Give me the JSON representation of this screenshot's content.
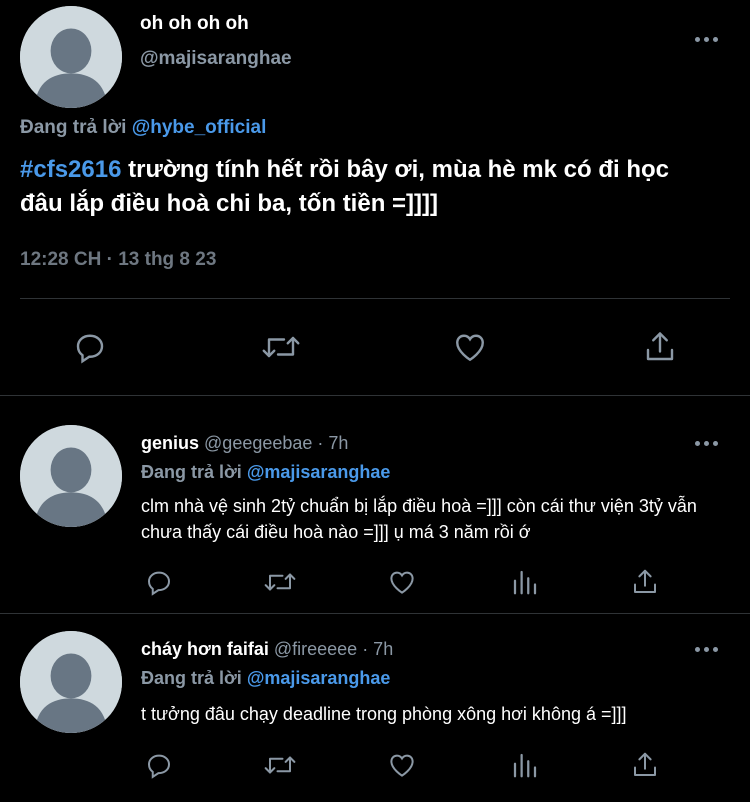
{
  "main_tweet": {
    "display_name": "oh oh oh oh",
    "handle": "@majisaranghae",
    "replying_label": "Đang trả lời",
    "replying_to": "@hybe_official",
    "hashtag": "#cfs2616",
    "text": " trường tính hết rồi bây ơi, mùa hè mk có đi học đâu lắp điều hoà chi ba, tốn tiền =]]]]",
    "timestamp": "12:28 CH · 13 thg 8 23",
    "actions": [
      "reply-icon",
      "retweet-icon",
      "like-icon",
      "share-icon"
    ]
  },
  "replies": [
    {
      "display_name": "genius",
      "handle": "@geegeebae",
      "time": "· 7h",
      "replying_label": "Đang trả lời",
      "replying_to": "@majisaranghae",
      "text": "clm nhà vệ sinh 2tỷ chuẩn bị lắp điều hoà =]]] còn cái thư viện 3tỷ vẫn chưa thấy cái điều hoà nào =]]] ụ má 3 năm rồi ớ",
      "actions": [
        "reply-icon",
        "retweet-icon",
        "like-icon",
        "views-icon",
        "share-icon"
      ]
    },
    {
      "display_name": "cháy hơn faifai",
      "handle": "@fireeeee",
      "time": "· 7h",
      "replying_label": "Đang trả lời",
      "replying_to": "@majisaranghae",
      "text": "t tưởng đâu chạy deadline trong phòng xông hơi không á =]]]",
      "actions": [
        "reply-icon",
        "retweet-icon",
        "like-icon",
        "views-icon",
        "share-icon"
      ]
    }
  ],
  "colors": {
    "background": "#000000",
    "link": "#4a99e9",
    "secondary_text": "#8b98a5",
    "divider": "#2f3336",
    "avatar_bg": "#cfd9de",
    "avatar_fg": "#687684"
  }
}
